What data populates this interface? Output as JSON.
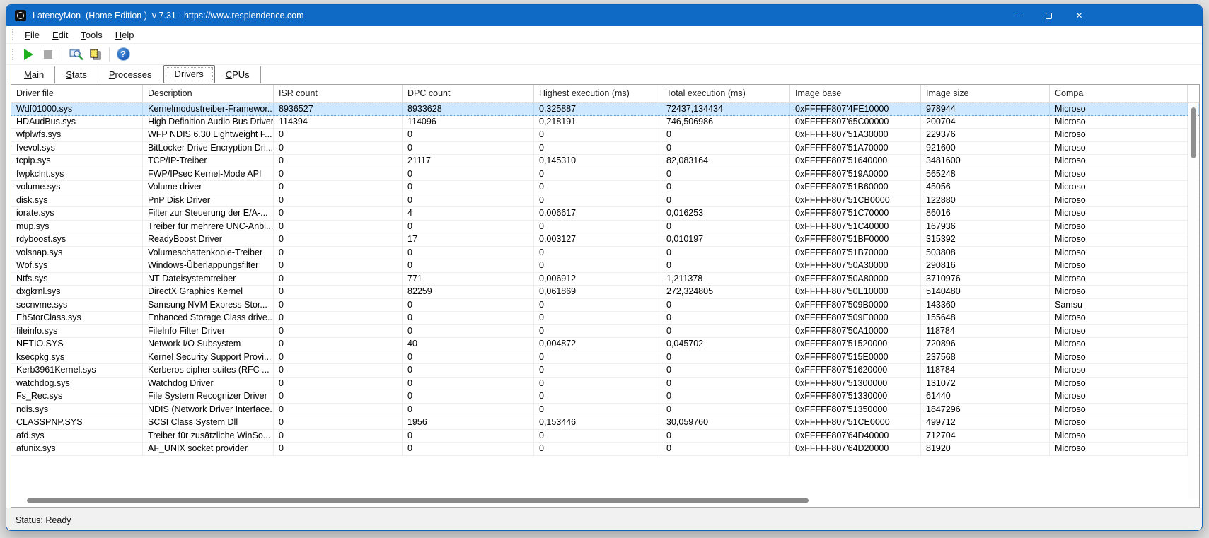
{
  "window": {
    "title": "LatencyMon  (Home Edition )  v 7.31 - https://www.resplendence.com",
    "titlebar_color": "#0e6ac4",
    "close_glyph": "✕"
  },
  "menu": {
    "items": [
      "File",
      "Edit",
      "Tools",
      "Help"
    ]
  },
  "toolbar": {
    "help_glyph": "?",
    "buttons": [
      "start-monitor",
      "stop-monitor",
      "analyze",
      "report",
      "help"
    ]
  },
  "tabs": {
    "items": [
      "Main",
      "Stats",
      "Processes",
      "Drivers",
      "CPUs"
    ],
    "active": "Drivers"
  },
  "table": {
    "columns": [
      "Driver file",
      "Description",
      "ISR count",
      "DPC count",
      "Highest execution (ms)",
      "Total execution (ms)",
      "Image base",
      "Image size",
      "Compa"
    ],
    "selected_row": 0,
    "rows": [
      [
        "Wdf01000.sys",
        "Kernelmodustreiber-Framewor...",
        "8936527",
        "8933628",
        "0,325887",
        "72437,134434",
        "0xFFFFF807'4FE10000",
        "978944",
        "Microso"
      ],
      [
        "HDAudBus.sys",
        "High Definition Audio Bus Driver",
        "114394",
        "114096",
        "0,218191",
        "746,506986",
        "0xFFFFF807'65C00000",
        "200704",
        "Microso"
      ],
      [
        "wfplwfs.sys",
        "WFP NDIS 6.30 Lightweight F...",
        "0",
        "0",
        "0",
        "0",
        "0xFFFFF807'51A30000",
        "229376",
        "Microso"
      ],
      [
        "fvevol.sys",
        "BitLocker Drive Encryption Dri...",
        "0",
        "0",
        "0",
        "0",
        "0xFFFFF807'51A70000",
        "921600",
        "Microso"
      ],
      [
        "tcpip.sys",
        "TCP/IP-Treiber",
        "0",
        "21117",
        "0,145310",
        "82,083164",
        "0xFFFFF807'51640000",
        "3481600",
        "Microso"
      ],
      [
        "fwpkclnt.sys",
        "FWP/IPsec Kernel-Mode API",
        "0",
        "0",
        "0",
        "0",
        "0xFFFFF807'519A0000",
        "565248",
        "Microso"
      ],
      [
        "volume.sys",
        "Volume driver",
        "0",
        "0",
        "0",
        "0",
        "0xFFFFF807'51B60000",
        "45056",
        "Microso"
      ],
      [
        "disk.sys",
        "PnP Disk Driver",
        "0",
        "0",
        "0",
        "0",
        "0xFFFFF807'51CB0000",
        "122880",
        "Microso"
      ],
      [
        "iorate.sys",
        "Filter zur Steuerung der E/A-...",
        "0",
        "4",
        "0,006617",
        "0,016253",
        "0xFFFFF807'51C70000",
        "86016",
        "Microso"
      ],
      [
        "mup.sys",
        "Treiber für mehrere UNC-Anbi...",
        "0",
        "0",
        "0",
        "0",
        "0xFFFFF807'51C40000",
        "167936",
        "Microso"
      ],
      [
        "rdyboost.sys",
        "ReadyBoost Driver",
        "0",
        "17",
        "0,003127",
        "0,010197",
        "0xFFFFF807'51BF0000",
        "315392",
        "Microso"
      ],
      [
        "volsnap.sys",
        "Volumeschattenkopie-Treiber",
        "0",
        "0",
        "0",
        "0",
        "0xFFFFF807'51B70000",
        "503808",
        "Microso"
      ],
      [
        "Wof.sys",
        "Windows-Überlappungsfilter",
        "0",
        "0",
        "0",
        "0",
        "0xFFFFF807'50A30000",
        "290816",
        "Microso"
      ],
      [
        "Ntfs.sys",
        "NT-Dateisystemtreiber",
        "0",
        "771",
        "0,006912",
        "1,211378",
        "0xFFFFF807'50A80000",
        "3710976",
        "Microso"
      ],
      [
        "dxgkrnl.sys",
        "DirectX Graphics Kernel",
        "0",
        "82259",
        "0,061869",
        "272,324805",
        "0xFFFFF807'50E10000",
        "5140480",
        "Microso"
      ],
      [
        "secnvme.sys",
        "Samsung NVM Express Stor...",
        "0",
        "0",
        "0",
        "0",
        "0xFFFFF807'509B0000",
        "143360",
        "Samsu"
      ],
      [
        "EhStorClass.sys",
        "Enhanced Storage Class drive...",
        "0",
        "0",
        "0",
        "0",
        "0xFFFFF807'509E0000",
        "155648",
        "Microso"
      ],
      [
        "fileinfo.sys",
        "FileInfo Filter Driver",
        "0",
        "0",
        "0",
        "0",
        "0xFFFFF807'50A10000",
        "118784",
        "Microso"
      ],
      [
        "NETIO.SYS",
        "Network I/O Subsystem",
        "0",
        "40",
        "0,004872",
        "0,045702",
        "0xFFFFF807'51520000",
        "720896",
        "Microso"
      ],
      [
        "ksecpkg.sys",
        "Kernel Security Support Provi...",
        "0",
        "0",
        "0",
        "0",
        "0xFFFFF807'515E0000",
        "237568",
        "Microso"
      ],
      [
        "Kerb3961Kernel.sys",
        "Kerberos cipher suites (RFC ...",
        "0",
        "0",
        "0",
        "0",
        "0xFFFFF807'51620000",
        "118784",
        "Microso"
      ],
      [
        "watchdog.sys",
        "Watchdog Driver",
        "0",
        "0",
        "0",
        "0",
        "0xFFFFF807'51300000",
        "131072",
        "Microso"
      ],
      [
        "Fs_Rec.sys",
        "File System Recognizer Driver",
        "0",
        "0",
        "0",
        "0",
        "0xFFFFF807'51330000",
        "61440",
        "Microso"
      ],
      [
        "ndis.sys",
        "NDIS (Network Driver Interface...",
        "0",
        "0",
        "0",
        "0",
        "0xFFFFF807'51350000",
        "1847296",
        "Microso"
      ],
      [
        "CLASSPNP.SYS",
        "SCSI Class System Dll",
        "0",
        "1956",
        "0,153446",
        "30,059760",
        "0xFFFFF807'51CE0000",
        "499712",
        "Microso"
      ],
      [
        "afd.sys",
        "Treiber für zusätzliche WinSo...",
        "0",
        "0",
        "0",
        "0",
        "0xFFFFF807'64D40000",
        "712704",
        "Microso"
      ],
      [
        "afunix.sys",
        "AF_UNIX socket provider",
        "0",
        "0",
        "0",
        "0",
        "0xFFFFF807'64D20000",
        "81920",
        "Microso"
      ]
    ]
  },
  "status_bar": {
    "text": "Status: Ready"
  }
}
